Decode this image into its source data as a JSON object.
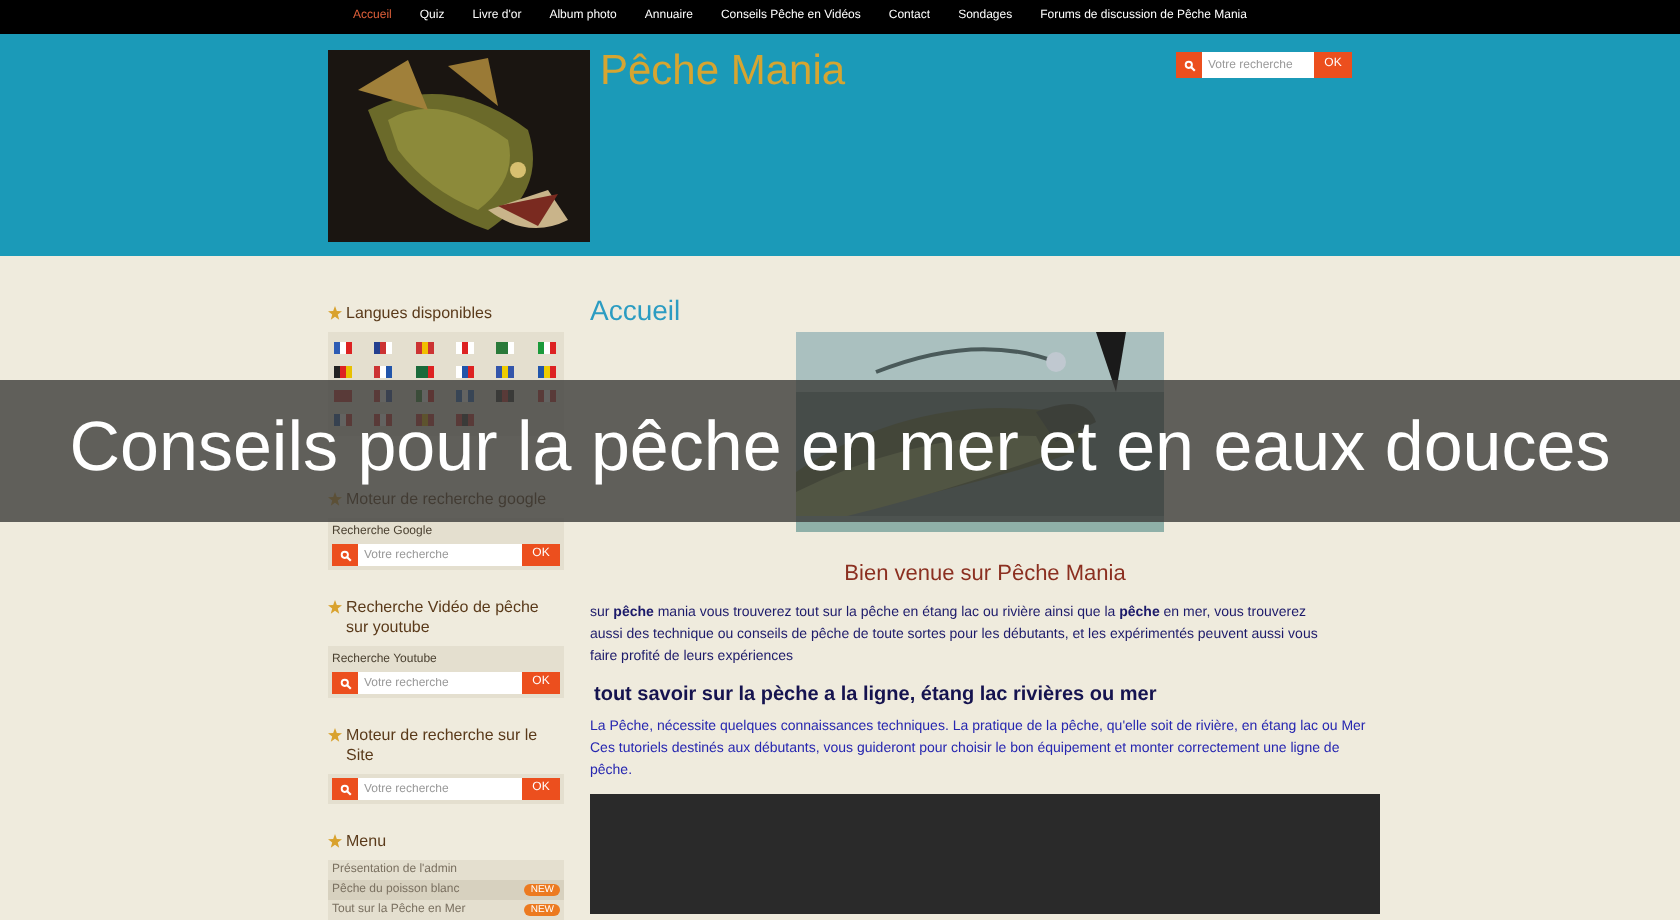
{
  "nav": [
    {
      "label": "Accueil",
      "selected": true
    },
    {
      "label": "Quiz",
      "selected": false
    },
    {
      "label": "Livre d'or",
      "selected": false
    },
    {
      "label": "Album photo",
      "selected": false
    },
    {
      "label": "Annuaire",
      "selected": false
    },
    {
      "label": "Conseils Pêche en Vidéos",
      "selected": false
    },
    {
      "label": "Contact",
      "selected": false
    },
    {
      "label": "Sondages",
      "selected": false
    },
    {
      "label": "Forums de discussion de Pêche Mania",
      "selected": false
    }
  ],
  "header": {
    "site_title": "Pêche Mania",
    "search": {
      "placeholder": "Votre recherche",
      "button": "OK"
    }
  },
  "sidebar": [
    {
      "kind": "flags",
      "title": "Langues disponibles"
    },
    {
      "kind": "search",
      "title": "Moteur de recherche google",
      "label": "Recherche Google",
      "placeholder": "Votre recherche",
      "button": "OK"
    },
    {
      "kind": "search",
      "title": "Recherche Vidéo de pêche sur youtube",
      "label": "Recherche Youtube",
      "placeholder": "Votre recherche",
      "button": "OK"
    },
    {
      "kind": "search",
      "title": "Moteur de recherche sur le Site",
      "placeholder": "Votre recherche",
      "button": "OK"
    },
    {
      "kind": "menu",
      "title": "Menu",
      "items": [
        {
          "label": "Présentation de l'admin",
          "selected": false
        },
        {
          "label": "Pêche du poisson blanc",
          "selected": true,
          "badge": "NEW"
        },
        {
          "label": "Tout sur la Pêche en Mer",
          "selected": false,
          "badge": "NEW"
        }
      ]
    }
  ],
  "main": {
    "title": "Accueil",
    "welcome": "Bien venue sur Pêche Mania",
    "intro": "sur **pêche** mania vous trouverez tout sur la pêche en étang lac ou rivière ainsi que la **pêche** en mer, vous trouverez aussi des technique ou conseils de pêche de toute sortes pour les débutants, et les expérimentés peuvent aussi vous faire profité de leurs expériences",
    "subtitle": "tout savoir sur la pèche a la ligne, étang lac rivières ou mer",
    "text": "La Pêche, nécessite quelques connaissances techniques. La pratique de la pêche, qu'elle soit de rivière, en étang lac ou Mer Ces tutoriels destinés aux débutants, vous guideront pour choisir le bon équipement et monter correctement une ligne de pêche."
  },
  "banner": "Conseils pour la pêche en mer et en eaux douces"
}
